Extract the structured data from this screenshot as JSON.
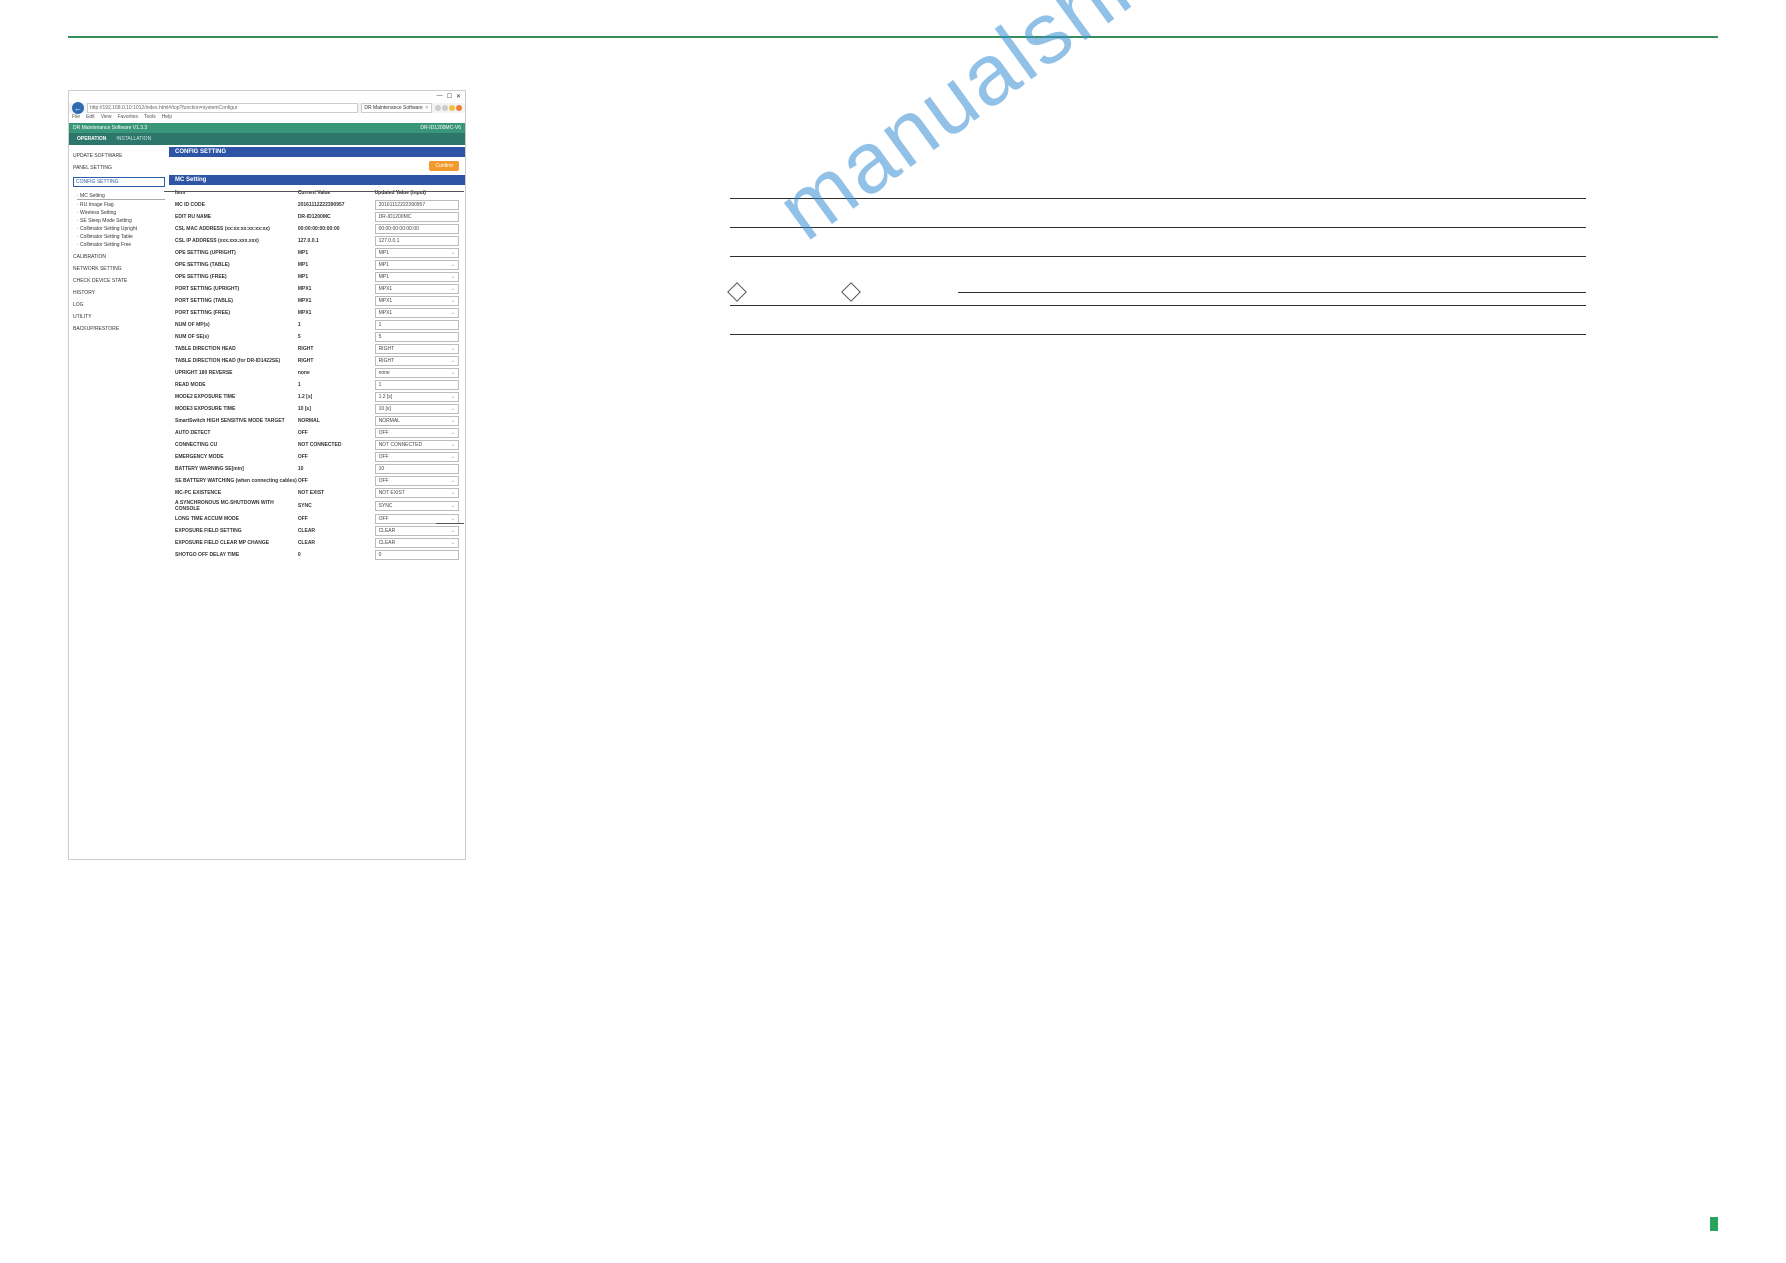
{
  "browser": {
    "url": "http://192.168.0.10:1012/index.html#/top?function=systemConfigur",
    "tab_title": "DR Maintenance Software",
    "window_min": "—",
    "window_max": "☐",
    "window_close": "✕",
    "star_colors": [
      "#ccc",
      "#ccc",
      "#f0c040",
      "#f08030"
    ],
    "menus": [
      "File",
      "Edit",
      "View",
      "Favorites",
      "Tools",
      "Help"
    ]
  },
  "app": {
    "title": "DR Maintenance Software V1.3.3",
    "device": "DR-ID1200MC-V6",
    "tab_operation": "OPERATION",
    "tab_installation": "INSTALLATION"
  },
  "sidebar": {
    "items": [
      "UPDATE SOFTWARE",
      "PANEL SETTING",
      "CONFIG SETTING",
      "CALIBRATION",
      "NETWORK SETTING",
      "CHECK DEVICE STATE",
      "HISTORY",
      "LOG",
      "UTILITY",
      "BACKUP/RESTORE"
    ],
    "config_sub": [
      "MC Setting",
      "RU Image Flag",
      "Wireless Setting",
      "SE Sleep Mode Setting",
      "Collimator Setting Upright",
      "Collimator Setting Table",
      "Collimator Setting Free"
    ]
  },
  "panel": {
    "title": "CONFIG SETTING",
    "confirm": "Confirm",
    "sub_title": "MC Setting",
    "headers": {
      "c1": "Item",
      "c2": "Current Value",
      "c3": "Updated Value (input)"
    },
    "rows": [
      {
        "item": "MC ID CODE",
        "cur": "20161112222390957",
        "val": "20161112222390957",
        "sel": false
      },
      {
        "item": "EDIT RU NAME",
        "cur": "DR-ID1200MC",
        "val": "DR-ID1200MC",
        "sel": false
      },
      {
        "item": "CSL MAC ADDRESS (xx:xx:xx:xx:xx:xx)",
        "cur": "00:00:00:00:00:00",
        "val": "00:00:00:00:00:00",
        "sel": false
      },
      {
        "item": "CSL IP ADDRESS (xxx.xxx.xxx.xxx)",
        "cur": "127.0.0.1",
        "val": "127.0.0.1",
        "sel": false
      },
      {
        "item": "OPE SETTING (UPRIGHT)",
        "cur": "MP1",
        "val": "MP1",
        "sel": true
      },
      {
        "item": "OPE SETTING (TABLE)",
        "cur": "MP1",
        "val": "MP1",
        "sel": true
      },
      {
        "item": "OPE SETTING (FREE)",
        "cur": "MP1",
        "val": "MP1",
        "sel": true
      },
      {
        "item": "PORT SETTING (UPRIGHT)",
        "cur": "MPX1",
        "val": "MPX1",
        "sel": true
      },
      {
        "item": "PORT SETTING (TABLE)",
        "cur": "MPX1",
        "val": "MPX1",
        "sel": true
      },
      {
        "item": "PORT SETTING (FREE)",
        "cur": "MPX1",
        "val": "MPX1",
        "sel": true
      },
      {
        "item": "NUM OF MP(s)",
        "cur": "1",
        "val": "1",
        "sel": false
      },
      {
        "item": "NUM OF SE(s)",
        "cur": "5",
        "val": "5",
        "sel": false
      },
      {
        "item": "TABLE DIRECTION HEAD",
        "cur": "RIGHT",
        "val": "RIGHT",
        "sel": true
      },
      {
        "item": "TABLE DIRECTION HEAD (for DR-ID1422SE)",
        "cur": "RIGHT",
        "val": "RIGHT",
        "sel": true
      },
      {
        "item": "UPRIGHT 180 REVERSE",
        "cur": "none",
        "val": "none",
        "sel": true
      },
      {
        "item": "READ MODE",
        "cur": "1",
        "val": "1",
        "sel": false
      },
      {
        "item": "MODE2 EXPOSURE TIME",
        "cur": "1.2 [s]",
        "val": "1.2 [s]",
        "sel": true
      },
      {
        "item": "MODE3 EXPOSURE TIME",
        "cur": "10 [s]",
        "val": "10 [s]",
        "sel": true
      },
      {
        "item": "SmartSwitch HIGH SENSITIVE MODE TARGET",
        "cur": "NORMAL",
        "val": "NORMAL",
        "sel": true
      },
      {
        "item": "AUTO DETECT",
        "cur": "OFF",
        "val": "OFF",
        "sel": true
      },
      {
        "item": "CONNECTING CU",
        "cur": "NOT CONNECTED",
        "val": "NOT CONNECTED",
        "sel": true
      },
      {
        "item": "EMERGENCY MODE",
        "cur": "OFF",
        "val": "OFF",
        "sel": true
      },
      {
        "item": "BATTERY WARNING SE[min]",
        "cur": "10",
        "val": "10",
        "sel": false
      },
      {
        "item": "SE BATTERY WATCHING (when connecting cables)",
        "cur": "OFF",
        "val": "OFF",
        "sel": true
      },
      {
        "item": "MC-PC EXISTENCE",
        "cur": "NOT EXIST",
        "val": "NOT EXIST",
        "sel": true
      },
      {
        "item": "A SYNCHRONOUS MC-SHUTDOWN WITH CONSOLE",
        "cur": "SYNC",
        "val": "SYNC",
        "sel": true
      },
      {
        "item": "LONG TIME ACCUM MODE",
        "cur": "OFF",
        "val": "OFF",
        "sel": true
      },
      {
        "item": "EXPOSURE FIELD SETTING",
        "cur": "CLEAR",
        "val": "CLEAR",
        "sel": true
      },
      {
        "item": "EXPOSURE FIELD CLEAR MP CHANGE",
        "cur": "CLEAR",
        "val": "CLEAR",
        "sel": true
      },
      {
        "item": "SHOTGO OFF DELAY TIME",
        "cur": "0",
        "val": "0",
        "sel": false
      }
    ]
  },
  "watermark": "manualshive.com"
}
